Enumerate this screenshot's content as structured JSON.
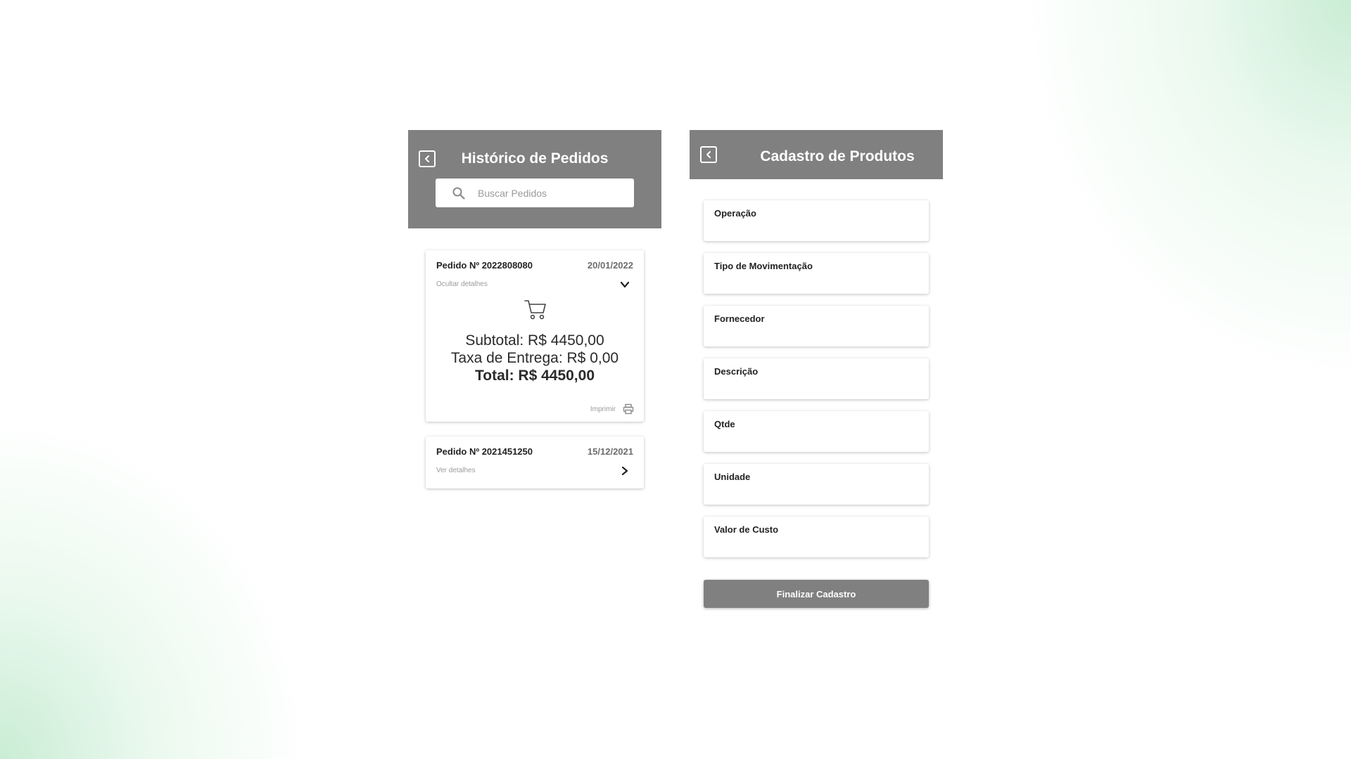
{
  "orders_panel": {
    "title": "Histórico de Pedidos",
    "back_icon": "back-arrow-icon",
    "search": {
      "placeholder": "Buscar Pedidos",
      "value": "",
      "icon": "search-icon"
    },
    "orders": [
      {
        "number": "Pedido Nº 2022808080",
        "date": "20/01/2022",
        "toggle_label": "Ocultar detalhes",
        "expanded": true,
        "toggle_icon": "chevron-down-icon",
        "cart_icon": "cart-icon",
        "subtotal": "Subtotal: R$ 4450,00",
        "delivery_fee": "Taxa de Entrega: R$ 0,00",
        "total": "Total: R$ 4450,00",
        "print_label": "Imprimir",
        "print_icon": "printer-icon"
      },
      {
        "number": "Pedido Nº 2021451250",
        "date": "15/12/2021",
        "toggle_label": "Ver detalhes",
        "expanded": false,
        "toggle_icon": "chevron-right-icon"
      }
    ]
  },
  "products_panel": {
    "title": "Cadastro de Produtos",
    "back_icon": "back-arrow-icon",
    "fields": [
      {
        "label": "Operação",
        "value": ""
      },
      {
        "label": "Tipo de Movimentação",
        "value": ""
      },
      {
        "label": "Fornecedor",
        "value": ""
      },
      {
        "label": "Descrição",
        "value": ""
      },
      {
        "label": "Qtde",
        "value": ""
      },
      {
        "label": "Unidade",
        "value": ""
      },
      {
        "label": "Valor de Custo",
        "value": ""
      }
    ],
    "submit_label": "Finalizar Cadastro"
  },
  "colors": {
    "header_gray": "#808080",
    "background": "#ffffff",
    "background_accent_green": "#9edeb2",
    "text_dark": "#222222",
    "text_muted": "#9a9a9a"
  }
}
